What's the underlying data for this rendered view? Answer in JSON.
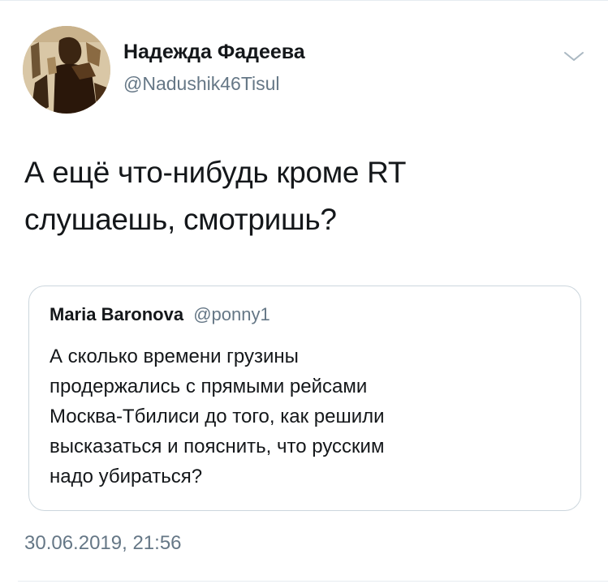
{
  "author": {
    "name": "Надежда Фадеева",
    "handle": "@Nadushik46Tisul",
    "avatar_icon": "profile-photo"
  },
  "menu": {
    "icon": "chevron-down-icon"
  },
  "tweet": {
    "lines": [
      "А ещё что-нибудь кроме RT",
      "слушаешь, смотришь?"
    ]
  },
  "quoted_tweet": {
    "name": "Maria Baronova",
    "handle": "@ponny1",
    "lines": [
      "А сколько времени грузины",
      "продержались с прямыми рейсами",
      "Москва-Тбилиси до того, как решили",
      "высказаться и пояснить, что русским",
      "надо убираться?"
    ]
  },
  "timestamp": "30.06.2019, 21:56",
  "colors": {
    "text_primary": "#14171a",
    "text_secondary": "#657786",
    "border": "#ccd6dd"
  }
}
